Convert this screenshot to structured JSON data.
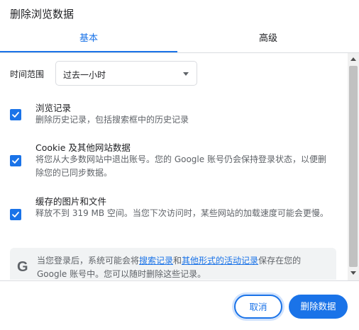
{
  "dialog": {
    "title": "删除浏览数据"
  },
  "tabs": [
    {
      "label": "基本",
      "selected": true
    },
    {
      "label": "高级",
      "selected": false
    }
  ],
  "time_range": {
    "label": "时间范围",
    "value": "过去一小时"
  },
  "options": [
    {
      "title": "浏览记录",
      "description": "删除历史记录，包括搜索框中的历史记录",
      "checked": true
    },
    {
      "title": "Cookie 及其他网站数据",
      "description": "将您从大多数网站中退出账号。您的 Google 账号仍会保持登录状态，以便删除您的已同步数据。",
      "checked": true
    },
    {
      "title": "缓存的图片和文件",
      "description": "释放不到 319 MB 空间。当您下次访问时，某些网站的加载速度可能会更慢。",
      "checked": true
    }
  ],
  "info": {
    "icon": "google-g-icon",
    "text_before": "当您登录后，系统可能会将",
    "link1": "搜索记录",
    "text_middle": "和",
    "link2": "其他形式的活动记录",
    "text_after": "保存在您的 Google 账号中。您可以随时删除这些记录。"
  },
  "buttons": {
    "cancel": "取消",
    "clear": "删除数据"
  },
  "colors": {
    "accent": "#1a73e8",
    "text": "#202124",
    "secondary_text": "#5f6368"
  }
}
